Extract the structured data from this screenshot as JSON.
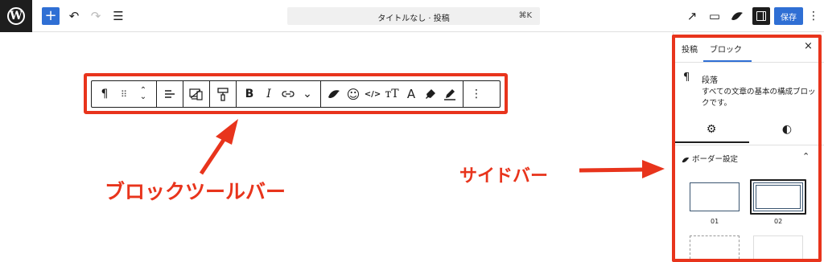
{
  "topbar": {
    "logo": "wordpress-logo",
    "logo_letter": "W",
    "add_icon": "+",
    "undo_icon": "↶",
    "redo_icon": "↷",
    "list_icon": "☰",
    "command_title": "タイトルなし · 投稿",
    "command_shortcut": "⌘K",
    "external_icon": "↗",
    "view_icon": "▭",
    "more_icon": "⋮",
    "save_label": "保存"
  },
  "toolbar": {
    "paragraph_icon": "¶",
    "drag_icon": "⠿",
    "move_up_icon": "⌃",
    "move_down_icon": "⌄",
    "align_icon": "≡",
    "bold_label": "B",
    "italic_label": "I",
    "link_icon": "🔗",
    "more_chevron": "⌄",
    "emoji_icon": "☺",
    "code_icon": "</>",
    "font_size_label": "тT",
    "text_color_label": "A",
    "options_icon": "⋮"
  },
  "annotations": {
    "toolbar_label": "ブロックツールバー",
    "sidebar_label": "サイドバー"
  },
  "sidebar": {
    "tabs": [
      {
        "label": "投稿"
      },
      {
        "label": "ブロック"
      }
    ],
    "close_icon": "×",
    "block_icon": "¶",
    "block_name": "段落",
    "block_description": "すべての文章の基本の構成ブロックです。",
    "settings_tab_icon": "⚙",
    "styles_tab_icon": "◐",
    "panel_title": "ボーダー設定",
    "panel_chevron": "⌃",
    "presets": [
      {
        "label": "01"
      },
      {
        "label": "02"
      }
    ]
  },
  "colors": {
    "accent": "#2f6fd4",
    "annotation": "#e8341c",
    "dark": "#1e1e1e"
  }
}
